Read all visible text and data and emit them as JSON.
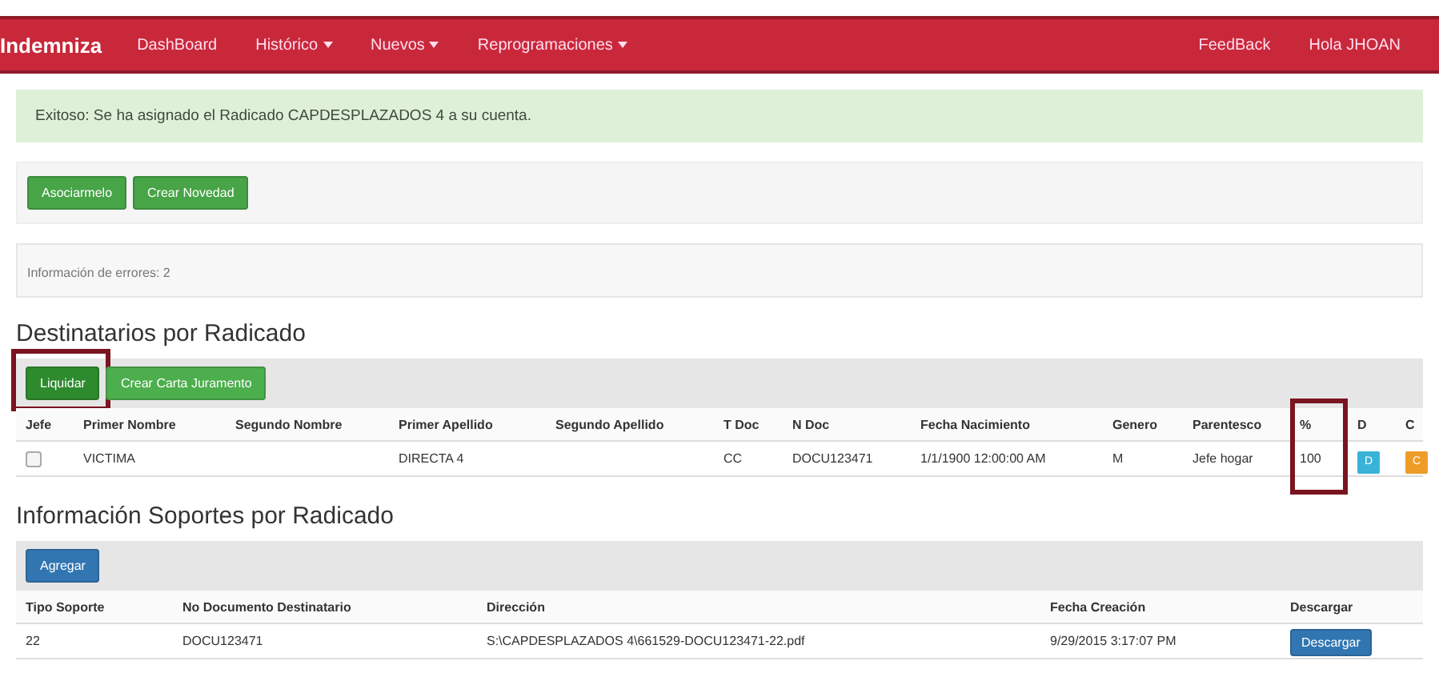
{
  "navbar": {
    "brand": "Indemniza",
    "items": [
      {
        "label": "DashBoard",
        "dropdown": false
      },
      {
        "label": "Histórico",
        "dropdown": true
      },
      {
        "label": "Nuevos",
        "dropdown": true
      },
      {
        "label": "Reprogramaciones",
        "dropdown": true
      }
    ],
    "right_items": [
      "FeedBack",
      "Hola JHOAN"
    ]
  },
  "alert": "Exitoso: Se ha asignado el Radicado CAPDESPLAZADOS 4 a su cuenta.",
  "actions": [
    "Asociarmelo",
    "Crear Novedad"
  ],
  "errors_info": "Información de errores: 2",
  "recipients": {
    "title": "Destinatarios por Radicado",
    "buttons": [
      {
        "label": "Liquidar",
        "highlighted": true
      },
      {
        "label": "Crear Carta Juramento",
        "highlighted": false
      }
    ],
    "columns": [
      {
        "label": "Jefe",
        "highlighted": false
      },
      {
        "label": "Primer Nombre",
        "highlighted": false
      },
      {
        "label": "Segundo Nombre",
        "highlighted": false
      },
      {
        "label": "Primer Apellido",
        "highlighted": false
      },
      {
        "label": "Segundo Apellido",
        "highlighted": false
      },
      {
        "label": "T Doc",
        "highlighted": false
      },
      {
        "label": "N Doc",
        "highlighted": false
      },
      {
        "label": "Fecha Nacimiento",
        "highlighted": false
      },
      {
        "label": "Genero",
        "highlighted": false
      },
      {
        "label": "Parentesco",
        "highlighted": false
      },
      {
        "label": "%",
        "highlighted": true
      },
      {
        "label": "D",
        "highlighted": false
      },
      {
        "label": "C",
        "highlighted": false
      }
    ],
    "rows": [
      {
        "checked": false,
        "cells": [
          "",
          "VICTIMA",
          "",
          "DIRECTA 4",
          "",
          "CC",
          "DOCU123471",
          "1/1/1900 12:00:00 AM",
          "M",
          "Jefe hogar",
          "100",
          "D",
          "C"
        ]
      }
    ]
  },
  "supports": {
    "title": "Información Soportes por Radicado",
    "add_button": "Agregar",
    "columns": [
      "Tipo Soporte",
      "No Documento Destinatario",
      "Dirección",
      "Fecha Creación",
      "Descargar"
    ],
    "rows": [
      {
        "cells": [
          "22",
          "DOCU123471",
          "S:\\CAPDESPLAZADOS 4\\661529-DOCU123471-22.pdf",
          "9/29/2015 3:17:07 PM"
        ],
        "download": "Descargar"
      }
    ]
  }
}
